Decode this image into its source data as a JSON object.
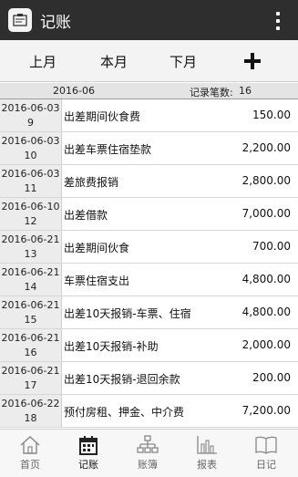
{
  "app": {
    "title": "记账",
    "icon": "ledger-app-icon"
  },
  "toolbar": {
    "prev_label": "上月",
    "current_label": "本月",
    "next_label": "下月",
    "add_icon": "plus-icon"
  },
  "summary": {
    "month": "2016-06",
    "count_label": "记录笔数:",
    "count_value": "16"
  },
  "records": [
    {
      "date": "2016-06-03",
      "seq": "9",
      "desc": "出差期间伙食费",
      "amount": "150.00"
    },
    {
      "date": "2016-06-03",
      "seq": "10",
      "desc": "出差车票住宿垫款",
      "amount": "2,200.00"
    },
    {
      "date": "2016-06-03",
      "seq": "11",
      "desc": "差旅费报销",
      "amount": "2,800.00"
    },
    {
      "date": "2016-06-10",
      "seq": "12",
      "desc": "出差借款",
      "amount": "7,000.00"
    },
    {
      "date": "2016-06-21",
      "seq": "13",
      "desc": "出差期间伙食",
      "amount": "700.00"
    },
    {
      "date": "2016-06-21",
      "seq": "14",
      "desc": "车票住宿支出",
      "amount": "4,800.00"
    },
    {
      "date": "2016-06-21",
      "seq": "15",
      "desc": "出差10天报销-车票、住宿",
      "amount": "4,800.00"
    },
    {
      "date": "2016-06-21",
      "seq": "16",
      "desc": "出差10天报销-补助",
      "amount": "2,000.00"
    },
    {
      "date": "2016-06-21",
      "seq": "17",
      "desc": "出差10天报销-退回余款",
      "amount": "200.00"
    },
    {
      "date": "2016-06-22",
      "seq": "18",
      "desc": "预付房租、押金、中介费",
      "amount": "7,200.00"
    }
  ],
  "tabs": [
    {
      "label": "首页",
      "icon": "home-icon",
      "active": false
    },
    {
      "label": "记账",
      "icon": "calendar-icon",
      "active": true
    },
    {
      "label": "账簿",
      "icon": "sitemap-icon",
      "active": false
    },
    {
      "label": "报表",
      "icon": "bar-chart-icon",
      "active": false
    },
    {
      "label": "日记",
      "icon": "book-icon",
      "active": false
    }
  ]
}
